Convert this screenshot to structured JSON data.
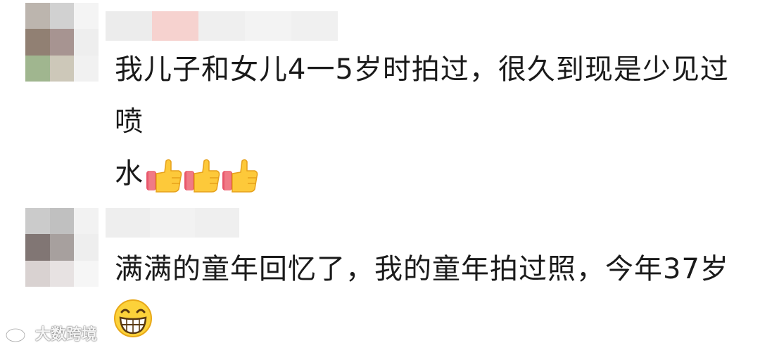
{
  "comments": [
    {
      "text": "我儿子和女儿4一5岁时拍过，很久到现是少见过喷",
      "text_line2": "水",
      "emoji": [
        "thumbs-up-icon",
        "thumbs-up-icon",
        "thumbs-up-icon"
      ],
      "avatar_colors": [
        "#b9b2aa",
        "#cfcfcf",
        "#f4f4f4",
        "#8c7a6c",
        "#a38f8c",
        "#eeeeee",
        "#9bb38a",
        "#cbc6b6",
        "#f1f1f1"
      ],
      "nick_colors": [
        "#ececec",
        "#f6d2cf",
        "#efefef",
        "#f3f3f3",
        "#f0f0f0"
      ]
    },
    {
      "text": "满满的童年回忆了，我的童年拍过照，今年37岁了",
      "emoji": [
        "grinning-face-icon"
      ],
      "avatar_colors": [
        "#c9c9c9",
        "#bdbdbd",
        "#f2f2f2",
        "#7b6f6d",
        "#a39b99",
        "#eeeeee",
        "#d8d0cf",
        "#e6e1e1",
        "#f6f6f6"
      ],
      "nick_colors": [
        "#eeeeee",
        "#f2f2f2",
        "#efefef"
      ]
    }
  ],
  "watermark": {
    "text": "大数跨境",
    "icon": "weibo-logo-icon"
  }
}
